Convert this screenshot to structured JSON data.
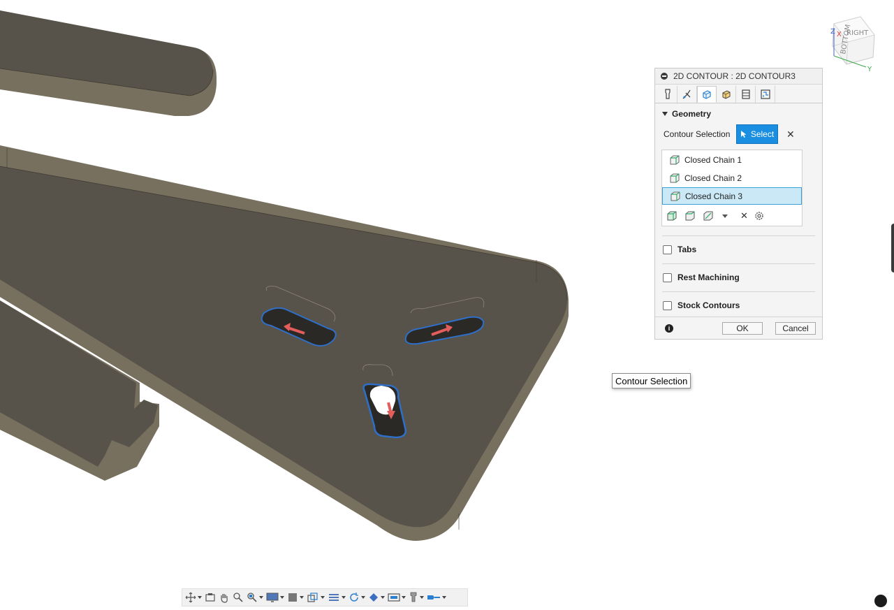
{
  "panel": {
    "title": "2D CONTOUR : 2D CONTOUR3",
    "tabs": [
      "tool-icon",
      "tool-holder-icon",
      "geometry-icon",
      "heights-icon",
      "passes-icon",
      "linking-icon"
    ],
    "geometry": {
      "title": "Geometry",
      "contour_selection_label": "Contour Selection",
      "select_label": "Select",
      "chains": [
        "Closed Chain 1",
        "Closed Chain 2",
        "Closed Chain 3"
      ],
      "selected_chain": "Closed Chain 3"
    },
    "sections": {
      "tabs": "Tabs",
      "rest_machining": "Rest Machining",
      "stock_contours": "Stock Contours"
    },
    "ok_label": "OK",
    "cancel_label": "Cancel",
    "info_glyph": "i"
  },
  "tooltip": "Contour Selection",
  "navcube": {
    "face_top": "RIGHT",
    "face_side": "BOTTOM",
    "axis_z": "Z",
    "axis_x": "X",
    "axis_y": "Y"
  },
  "colors": {
    "model_top": "#57534a",
    "model_side": "#77705f",
    "selection_outline": "#2f6fc8",
    "direction_arrow": "#e35d5d",
    "select_button": "#1a8ee0"
  }
}
